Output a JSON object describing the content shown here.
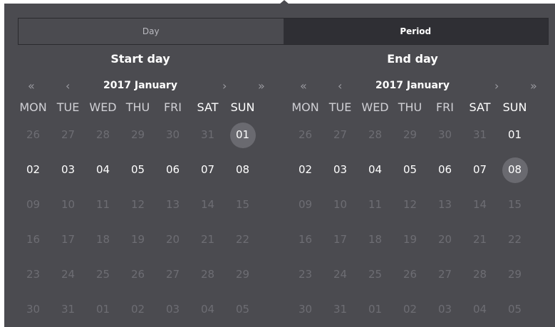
{
  "tabs": {
    "day": "Day",
    "period": "Period"
  },
  "start": {
    "title": "Start day",
    "nav": {
      "prev_year": "«",
      "prev_month": "‹",
      "month": "2017 January",
      "next_month": "›",
      "next_year": "»"
    },
    "weekdays": [
      "MON",
      "TUE",
      "WED",
      "THU",
      "FRI",
      "SAT",
      "SUN"
    ],
    "rows": [
      [
        "26",
        "27",
        "28",
        "29",
        "30",
        "31",
        "01"
      ],
      [
        "02",
        "03",
        "04",
        "05",
        "06",
        "07",
        "08"
      ],
      [
        "09",
        "10",
        "11",
        "12",
        "13",
        "14",
        "15"
      ],
      [
        "16",
        "17",
        "18",
        "19",
        "20",
        "21",
        "22"
      ],
      [
        "23",
        "24",
        "25",
        "26",
        "27",
        "28",
        "29"
      ],
      [
        "30",
        "31",
        "01",
        "02",
        "03",
        "04",
        "05"
      ]
    ]
  },
  "end": {
    "title": "End day",
    "nav": {
      "prev_year": "«",
      "prev_month": "‹",
      "month": "2017 January",
      "next_month": "›",
      "next_year": "»"
    },
    "weekdays": [
      "MON",
      "TUE",
      "WED",
      "THU",
      "FRI",
      "SAT",
      "SUN"
    ],
    "rows": [
      [
        "26",
        "27",
        "28",
        "29",
        "30",
        "31",
        "01"
      ],
      [
        "02",
        "03",
        "04",
        "05",
        "06",
        "07",
        "08"
      ],
      [
        "09",
        "10",
        "11",
        "12",
        "13",
        "14",
        "15"
      ],
      [
        "16",
        "17",
        "18",
        "19",
        "20",
        "21",
        "22"
      ],
      [
        "23",
        "24",
        "25",
        "26",
        "27",
        "28",
        "29"
      ],
      [
        "30",
        "31",
        "01",
        "02",
        "03",
        "04",
        "05"
      ]
    ]
  }
}
